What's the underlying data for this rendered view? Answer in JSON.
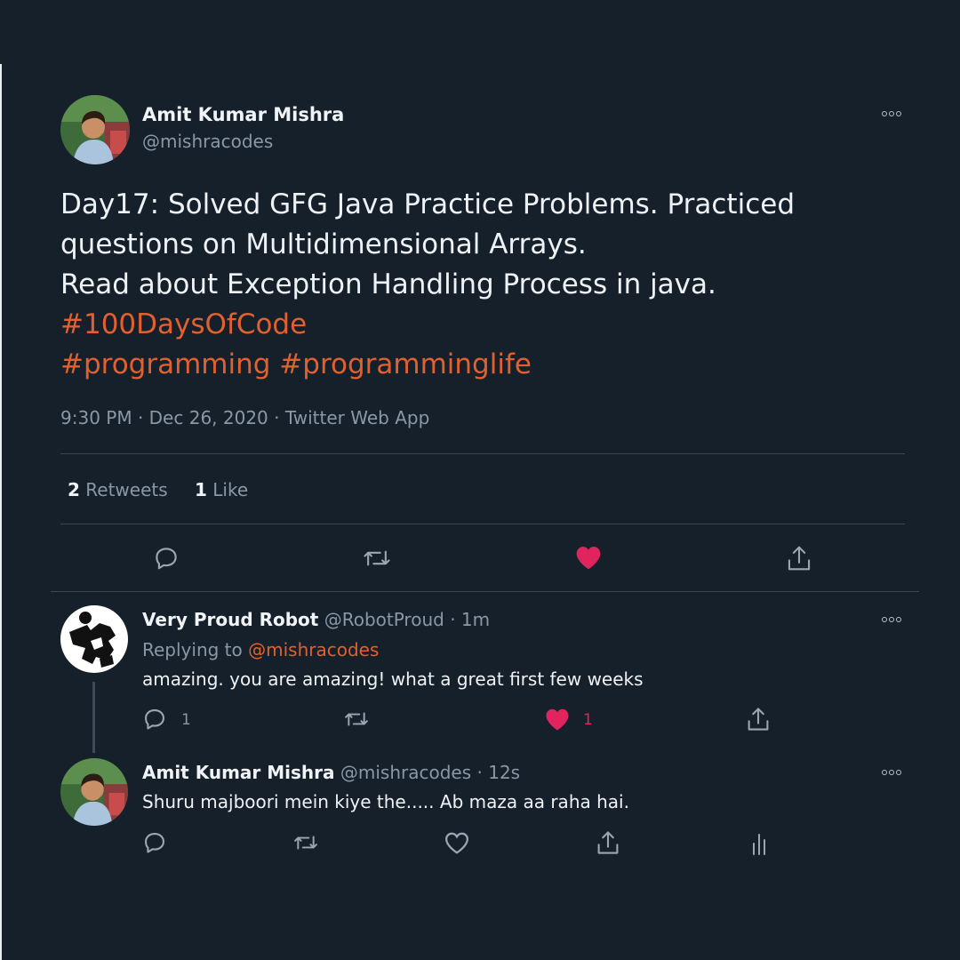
{
  "main_tweet": {
    "author_name": "Amit Kumar Mishra",
    "author_handle": "@mishracodes",
    "text_lines": [
      "Day17: Solved GFG Java Practice Problems. Practiced",
      "questions on Multidimensional Arrays.",
      "Read about Exception Handling Process in java."
    ],
    "hashtag_line_1": "#100DaysOfCode",
    "hashtag_line_2": "#programming #programminglife",
    "timestamp": "9:30 PM · Dec 26, 2020 · Twitter Web App",
    "retweets_count": "2",
    "retweets_label": "Retweets",
    "likes_count": "1",
    "likes_label": "Like",
    "liked": true
  },
  "reply_1": {
    "author_name": "Very Proud Robot",
    "author_handle": "@RobotProud",
    "time": "· 1m",
    "replying_prefix": "Replying to",
    "replying_to": "@mishracodes",
    "text": "amazing. you are amazing! what a great first few weeks",
    "reply_count": "1",
    "like_count": "1",
    "liked": true
  },
  "reply_2": {
    "author_name": "Amit Kumar Mishra",
    "author_handle": "@mishracodes",
    "time": "· 12s",
    "text": "Shuru majboori mein kiye the..... Ab maza aa raha hai."
  },
  "colors": {
    "background": "#16202b",
    "accent": "#e0602e",
    "like": "#e0245e",
    "muted": "#8a98a6"
  }
}
